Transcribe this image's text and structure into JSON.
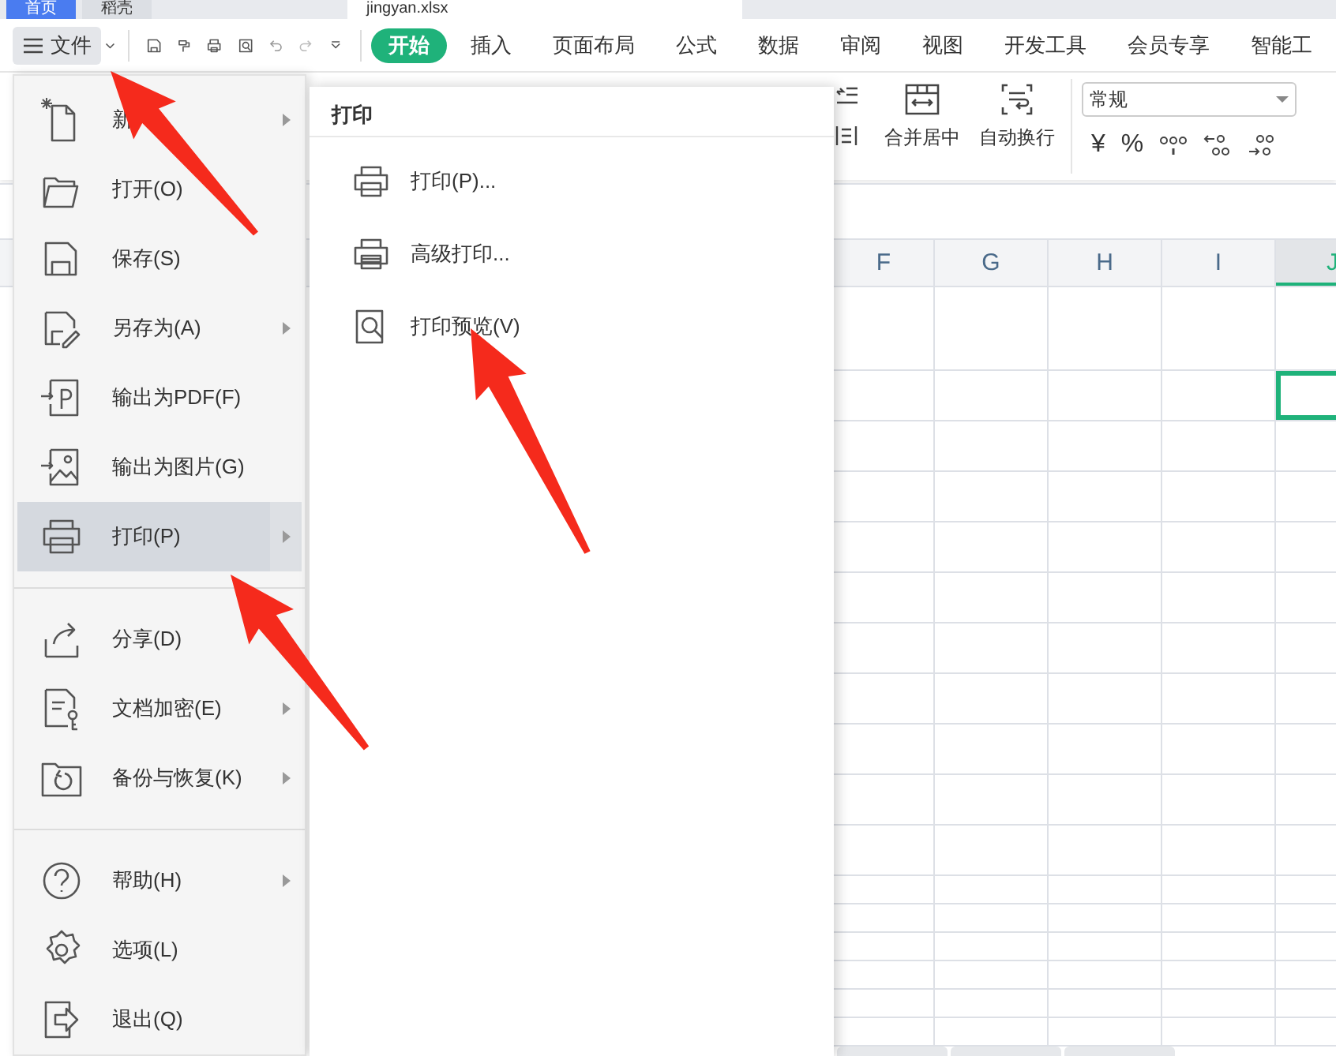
{
  "window_tabs": [
    {
      "label": "首页",
      "selected": false
    },
    {
      "label": "稻壳",
      "selected": false
    },
    {
      "label": "jingyan.xlsx",
      "selected": true
    }
  ],
  "toolbar": {
    "file_menu": "文件"
  },
  "ribbon_tabs": [
    {
      "label": "开始",
      "selected": true
    },
    {
      "label": "插入",
      "selected": false
    },
    {
      "label": "页面布局",
      "selected": false
    },
    {
      "label": "公式",
      "selected": false
    },
    {
      "label": "数据",
      "selected": false
    },
    {
      "label": "审阅",
      "selected": false
    },
    {
      "label": "视图",
      "selected": false
    },
    {
      "label": "开发工具",
      "selected": false
    },
    {
      "label": "会员专享",
      "selected": false
    },
    {
      "label": "智能工",
      "selected": false
    }
  ],
  "ribbon": {
    "merge": "合并居中",
    "wrap": "自动换行",
    "number_format": "常规",
    "currency": "¥",
    "percent": "%"
  },
  "file_menu": {
    "items": [
      {
        "kind": "new",
        "label": "新",
        "submenu": true,
        "selected": false
      },
      {
        "kind": "open",
        "label": "打开(O)",
        "submenu": false,
        "selected": false
      },
      {
        "kind": "save",
        "label": "保存(S)",
        "submenu": false,
        "selected": false
      },
      {
        "kind": "saveas",
        "label": "另存为(A)",
        "submenu": true,
        "selected": false
      },
      {
        "kind": "pdf",
        "label": "输出为PDF(F)",
        "submenu": false,
        "selected": false
      },
      {
        "kind": "image",
        "label": "输出为图片(G)",
        "submenu": false,
        "selected": false
      },
      {
        "kind": "print",
        "label": "打印(P)",
        "submenu": true,
        "selected": true
      },
      {
        "kind": "divider"
      },
      {
        "kind": "share",
        "label": "分享(D)",
        "submenu": false,
        "selected": false
      },
      {
        "kind": "encrypt",
        "label": "文档加密(E)",
        "submenu": true,
        "selected": false
      },
      {
        "kind": "backup",
        "label": "备份与恢复(K)",
        "submenu": true,
        "selected": false
      },
      {
        "kind": "divider"
      },
      {
        "kind": "help",
        "label": "帮助(H)",
        "submenu": true,
        "selected": false
      },
      {
        "kind": "options",
        "label": "选项(L)",
        "submenu": false,
        "selected": false
      },
      {
        "kind": "exit",
        "label": "退出(Q)",
        "submenu": false,
        "selected": false
      }
    ]
  },
  "print_submenu": {
    "title": "打印",
    "items": [
      {
        "kind": "print",
        "label": "打印(P)..."
      },
      {
        "kind": "advanced",
        "label": "高级打印..."
      },
      {
        "kind": "preview",
        "label": "打印预览(V)"
      }
    ]
  },
  "sheet": {
    "columns": [
      {
        "label": "F",
        "selected": false
      },
      {
        "label": "G",
        "selected": false
      },
      {
        "label": "H",
        "selected": false
      },
      {
        "label": "I",
        "selected": false
      },
      {
        "label": "J",
        "selected": true
      }
    ]
  }
}
